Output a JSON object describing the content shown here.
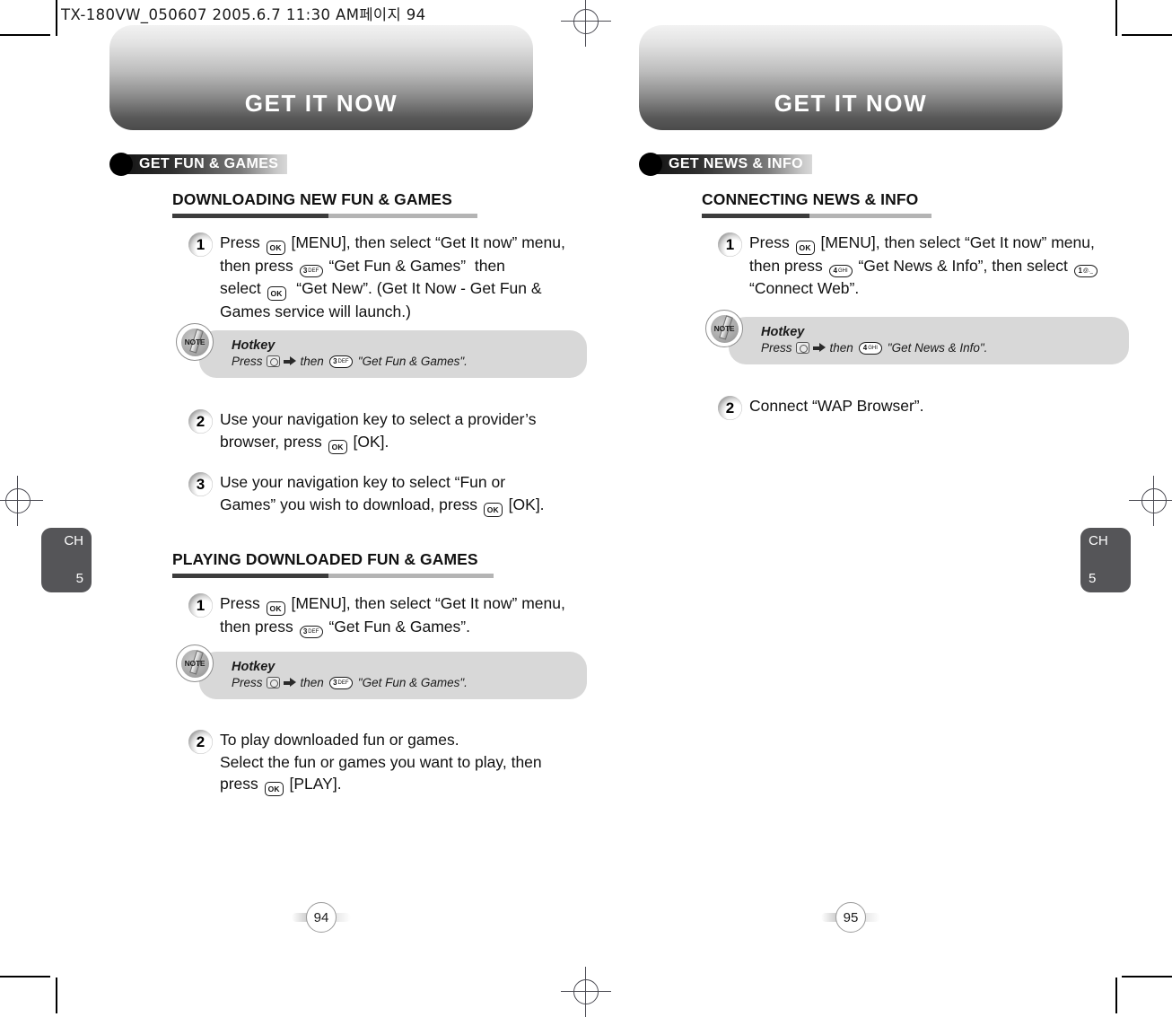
{
  "slug": "TX-180VW_050607  2005.6.7 11:30 AM페이지 94",
  "left_page": {
    "banner_title": "GET IT NOW",
    "badge": "GET FUN & GAMES",
    "chapter": {
      "letters": "CH",
      "number": "5"
    },
    "page_number": "94",
    "sections": [
      {
        "heading": "DOWNLOADING NEW FUN & GAMES",
        "steps": [
          {
            "num": "1",
            "lines": [
              "Press [ok] [MENU], then select “Get It now” menu,",
              "then press [3] “Get Fun & Games”  then",
              "select [ok]  “Get New”. (Get It Now - Get Fun &",
              "Games service will launch.)"
            ]
          }
        ],
        "note": {
          "badge_label": "NOTE",
          "title": "Hotkey",
          "press_label": "Press",
          "then_label": "then",
          "key": "3",
          "key_sup": "DEF",
          "target": "\"Get Fun & Games\"."
        },
        "after_note_steps": [
          {
            "num": "2",
            "lines": [
              "Use your navigation key to select a provider’s",
              "browser, press [ok] [OK]."
            ]
          },
          {
            "num": "3",
            "lines": [
              "Use your navigation key to select “Fun or",
              "Games” you wish to download, press [ok] [OK]."
            ]
          }
        ]
      },
      {
        "heading": "PLAYING DOWNLOADED FUN & GAMES",
        "steps": [
          {
            "num": "1",
            "lines": [
              "Press [ok] [MENU], then select “Get It now” menu,",
              "then press [3] “Get Fun & Games”."
            ]
          }
        ],
        "note": {
          "badge_label": "NOTE",
          "title": "Hotkey",
          "press_label": "Press",
          "then_label": "then",
          "key": "3",
          "key_sup": "DEF",
          "target": "\"Get Fun & Games\"."
        },
        "after_note_steps": [
          {
            "num": "2",
            "lines": [
              "To play downloaded fun or games.",
              "Select the fun or games you want to play, then",
              "press [ok] [PLAY]."
            ]
          }
        ]
      }
    ]
  },
  "right_page": {
    "banner_title": "GET IT NOW",
    "badge": "GET NEWS & INFO",
    "chapter": {
      "letters": "CH",
      "number": "5"
    },
    "page_number": "95",
    "sections": [
      {
        "heading": "CONNECTING NEWS & INFO",
        "steps": [
          {
            "num": "1",
            "lines": [
              "Press [ok] [MENU], then select “Get It now” menu,",
              "then press [4] “Get News & Info”, then select [1]",
              "“Connect Web”."
            ]
          }
        ],
        "note": {
          "badge_label": "NOTE",
          "title": "Hotkey",
          "press_label": "Press",
          "then_label": "then",
          "key": "4",
          "key_sup": "GHI",
          "target": "\"Get News & Info\"."
        },
        "after_note_steps": [
          {
            "num": "2",
            "lines": [
              "Connect “WAP Browser”."
            ]
          }
        ]
      }
    ]
  },
  "keys": {
    "ok": "OK",
    "three": "3",
    "three_sup": "DEF",
    "four": "4",
    "four_sup": "GHI",
    "one": "1",
    "one_sup": "@._"
  }
}
